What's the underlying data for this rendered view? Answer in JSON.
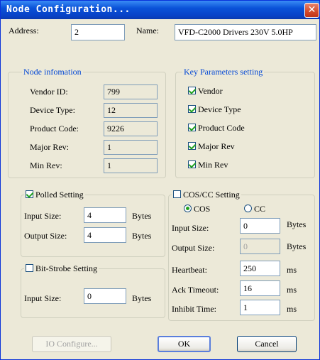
{
  "window": {
    "title": "Node Configuration...",
    "close_glyph": "✕"
  },
  "address": {
    "label": "Address:",
    "value": "2"
  },
  "name": {
    "label": "Name:",
    "value": "VFD-C2000 Drivers 230V 5.0HP"
  },
  "node_info": {
    "caption": "Node infomation",
    "rows": [
      {
        "label": "Vendor ID:",
        "value": "799"
      },
      {
        "label": "Device Type:",
        "value": "12"
      },
      {
        "label": "Product Code:",
        "value": "9226"
      },
      {
        "label": "Major Rev:",
        "value": "1"
      },
      {
        "label": "Min Rev:",
        "value": "1"
      }
    ]
  },
  "key_params": {
    "caption": "Key Parameters setting",
    "items": [
      {
        "label": "Vendor",
        "checked": true
      },
      {
        "label": "Device Type",
        "checked": true
      },
      {
        "label": "Product Code",
        "checked": true
      },
      {
        "label": "Major Rev",
        "checked": true
      },
      {
        "label": "Min Rev",
        "checked": true
      }
    ]
  },
  "polled": {
    "caption": "Polled Setting",
    "checked": true,
    "input_label": "Input Size:",
    "input_value": "4",
    "output_label": "Output Size:",
    "output_value": "4",
    "unit": "Bytes"
  },
  "bitstrobe": {
    "caption": "Bit-Strobe Setting",
    "checked": false,
    "input_label": "Input Size:",
    "input_value": "0",
    "unit": "Bytes"
  },
  "coscc": {
    "caption": "COS/CC Setting",
    "checked": false,
    "radio_cos": "COS",
    "radio_cc": "CC",
    "selected": "COS",
    "input_label": "Input Size:",
    "input_value": "0",
    "input_unit": "Bytes",
    "output_label": "Output Size:",
    "output_value": "0",
    "output_unit": "Bytes",
    "heartbeat_label": "Heartbeat:",
    "heartbeat_value": "250",
    "heartbeat_unit": "ms",
    "ack_label": "Ack Timeout:",
    "ack_value": "16",
    "ack_unit": "ms",
    "inhibit_label": "Inhibit Time:",
    "inhibit_value": "1",
    "inhibit_unit": "ms"
  },
  "buttons": {
    "io_configure": "IO Configure...",
    "ok": "OK",
    "cancel": "Cancel"
  }
}
